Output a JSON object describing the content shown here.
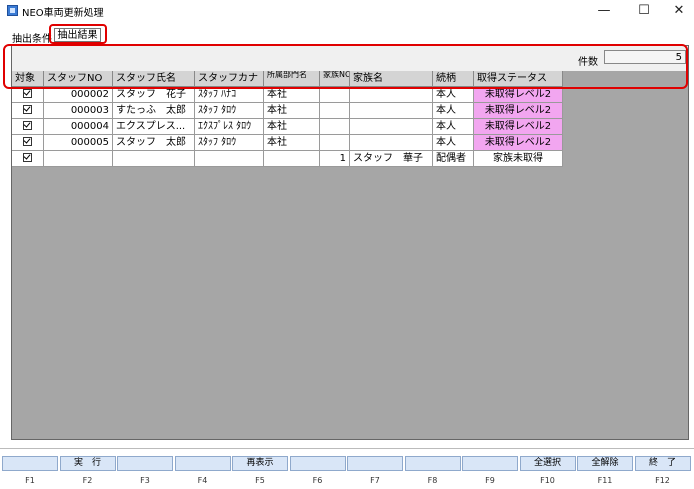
{
  "window": {
    "title": "NEO車両更新処理",
    "minimize": "—",
    "maximize": "☐",
    "close": "✕"
  },
  "tabs": {
    "conditions": "抽出条件",
    "results": "抽出結果"
  },
  "count": {
    "label": "件数",
    "value": "5"
  },
  "columns": [
    "対象",
    "スタッフNO",
    "スタッフ氏名",
    "スタッフカナ",
    "所属部門名",
    "家族NO",
    "家族名",
    "続柄",
    "取得ステータス"
  ],
  "rows": [
    {
      "checked": true,
      "staff_no": "000002",
      "name": "スタッフ　花子",
      "kana": "ｽﾀｯﾌ ﾊﾅｺ",
      "dept": "本社",
      "family_no": "",
      "family_name": "",
      "relation": "本人",
      "status": "未取得レベル2",
      "status_pink": true
    },
    {
      "checked": true,
      "staff_no": "000003",
      "name": "すたっふ　太郎",
      "kana": "ｽﾀｯﾌ ﾀﾛｳ",
      "dept": "本社",
      "family_no": "",
      "family_name": "",
      "relation": "本人",
      "status": "未取得レベル2",
      "status_pink": true
    },
    {
      "checked": true,
      "staff_no": "000004",
      "name": "エクスプレス...",
      "kana": "ｴｸｽﾌﾟﾚｽ ﾀﾛｳ",
      "dept": "本社",
      "family_no": "",
      "family_name": "",
      "relation": "本人",
      "status": "未取得レベル2",
      "status_pink": true
    },
    {
      "checked": true,
      "staff_no": "000005",
      "name": "スタッフ　太郎",
      "kana": "ｽﾀｯﾌ ﾀﾛｳ",
      "dept": "本社",
      "family_no": "",
      "family_name": "",
      "relation": "本人",
      "status": "未取得レベル2",
      "status_pink": true
    },
    {
      "checked": true,
      "staff_no": "",
      "name": "",
      "kana": "",
      "dept": "",
      "family_no": "1",
      "family_name": "スタッフ　華子",
      "relation": "配偶者",
      "status": "家族未取得",
      "status_pink": false
    }
  ],
  "fkeys": [
    {
      "key": "F1",
      "label": ""
    },
    {
      "key": "F2",
      "label": "実　行"
    },
    {
      "key": "F3",
      "label": ""
    },
    {
      "key": "F4",
      "label": ""
    },
    {
      "key": "F5",
      "label": "再表示"
    },
    {
      "key": "F6",
      "label": ""
    },
    {
      "key": "F7",
      "label": ""
    },
    {
      "key": "F8",
      "label": ""
    },
    {
      "key": "F9",
      "label": ""
    },
    {
      "key": "F10",
      "label": "全選択"
    },
    {
      "key": "F11",
      "label": "全解除"
    },
    {
      "key": "F12",
      "label": "終　了"
    }
  ]
}
